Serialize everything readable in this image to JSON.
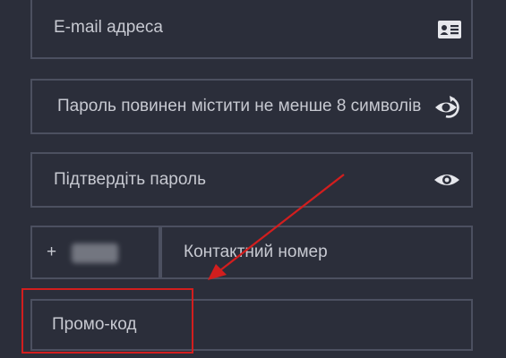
{
  "form": {
    "email": {
      "placeholder": "E-mail адреса",
      "icon": "id-card-icon"
    },
    "password": {
      "placeholder": "Пароль повинен містити не менше 8 символів",
      "icon": "eye-refresh-icon"
    },
    "confirm_password": {
      "placeholder": "Підтвердіть пароль",
      "icon": "eye-icon"
    },
    "country_code": {
      "prefix": "+"
    },
    "phone": {
      "placeholder": "Контактний номер"
    },
    "promo_code": {
      "placeholder": "Промо-код"
    }
  },
  "annotation": {
    "color": "#d21e1e"
  },
  "colors": {
    "background": "#2b2e3a",
    "border": "#4c5060",
    "text": "#c7c9d1",
    "icon": "#e6e7ec"
  }
}
